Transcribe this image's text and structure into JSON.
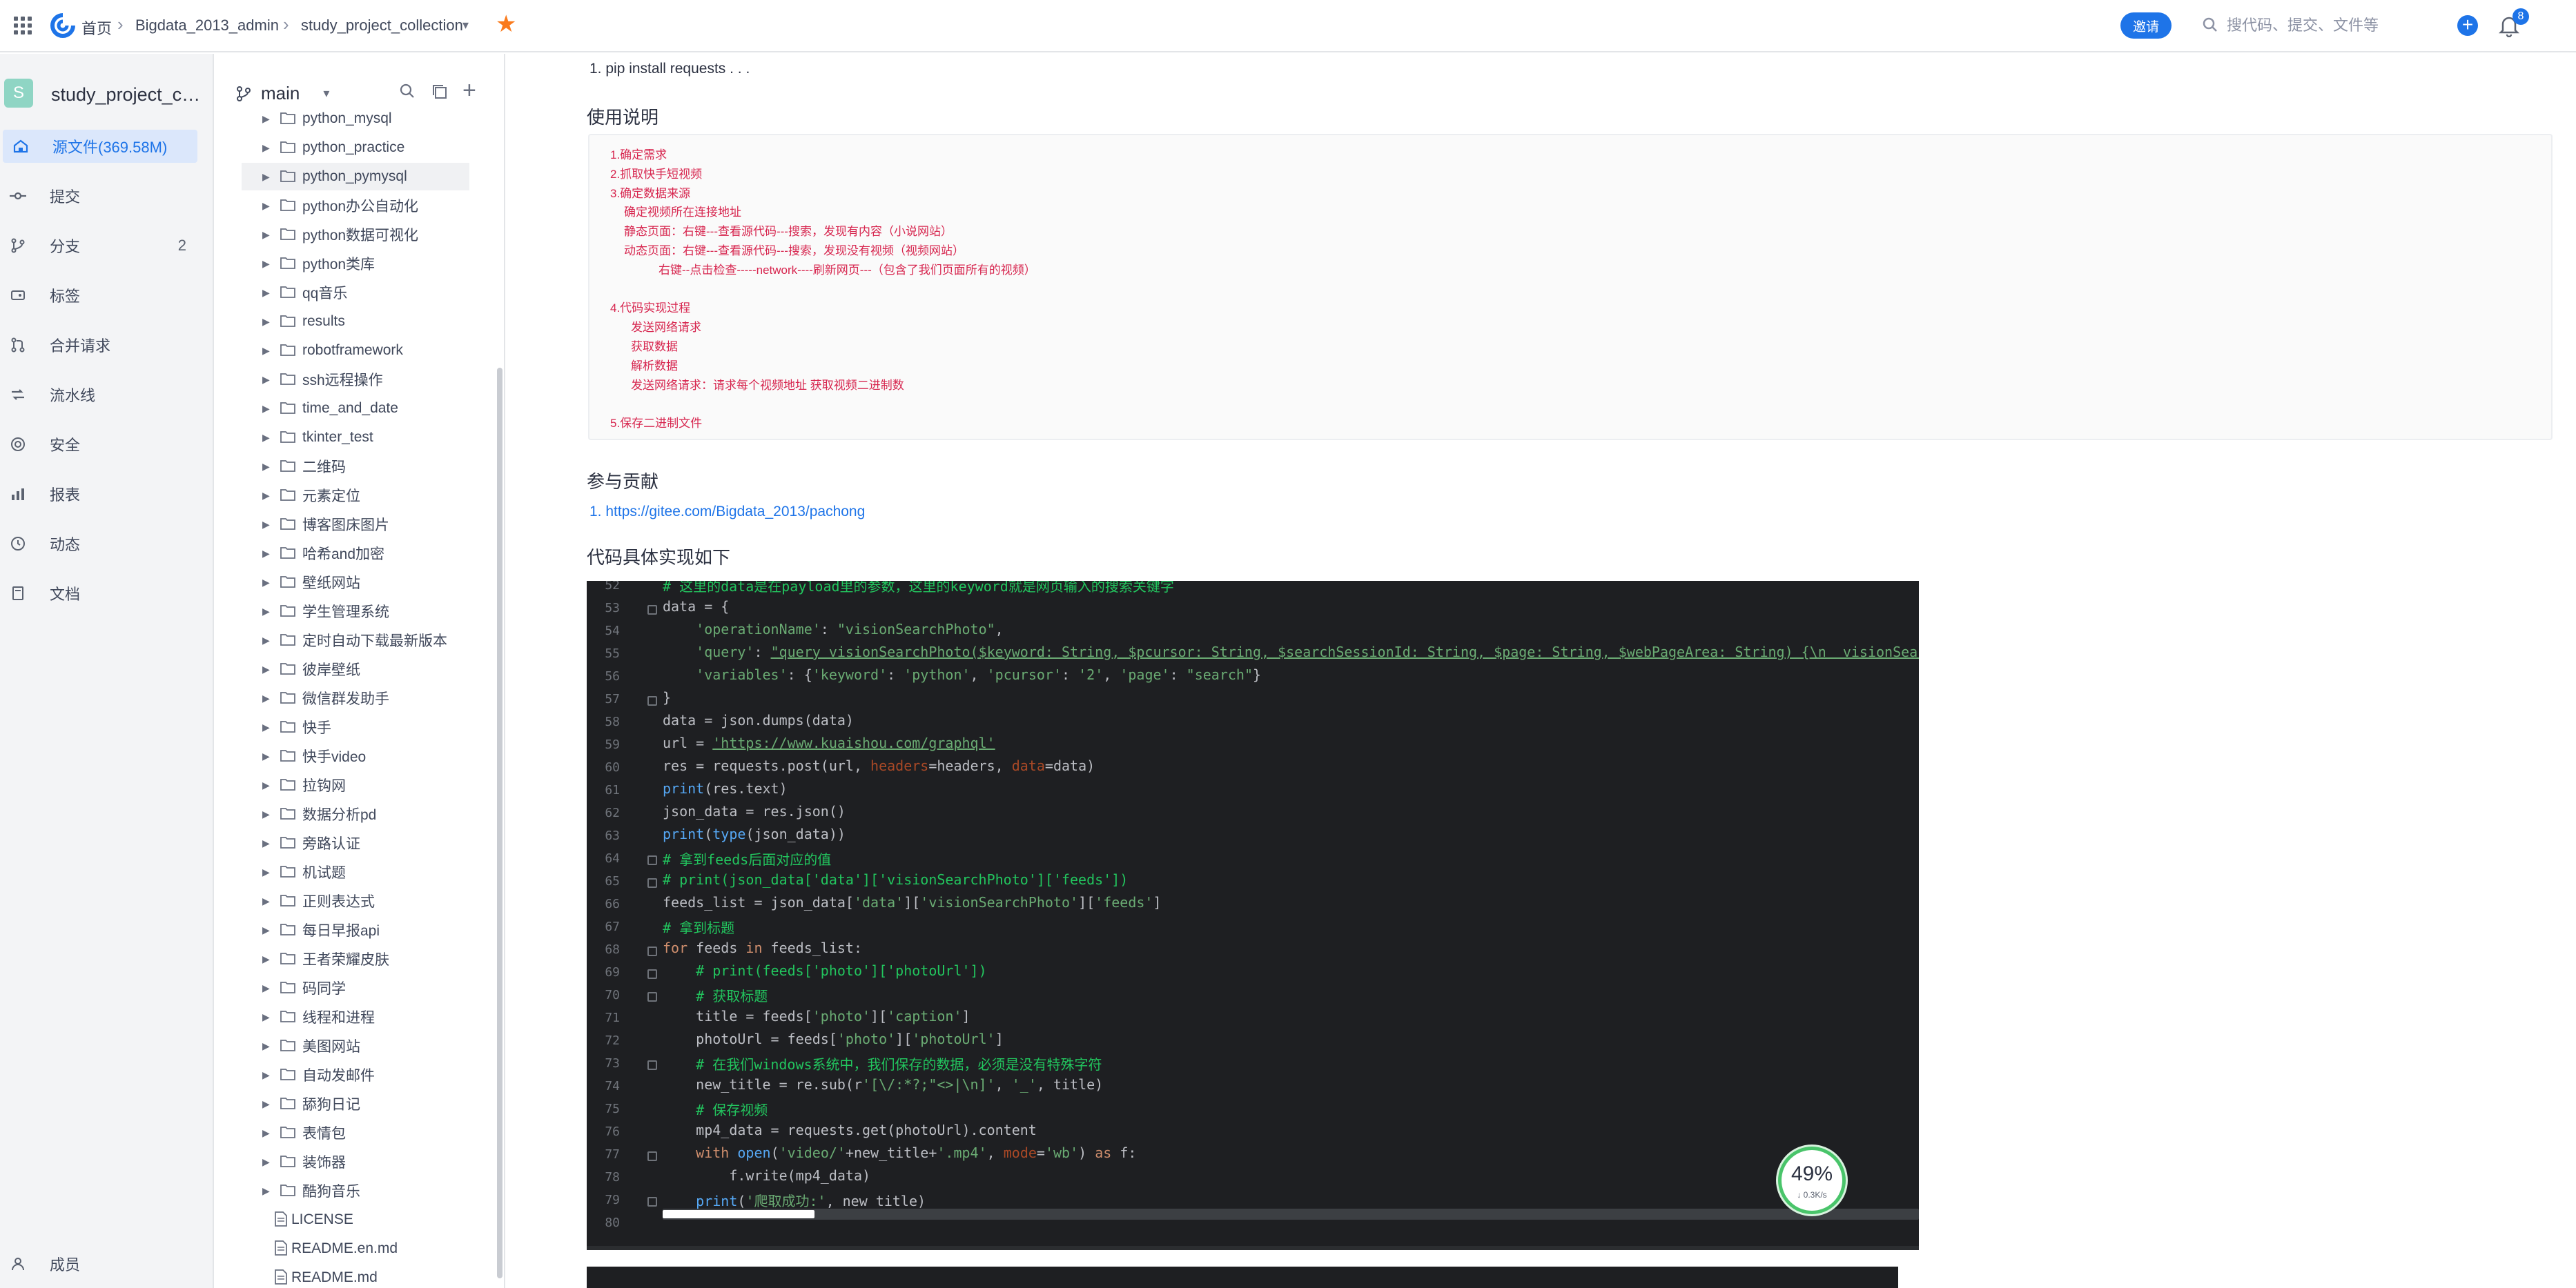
{
  "topbar": {
    "breadcrumb": [
      "首页",
      "Bigdata_2013_admin",
      "study_project_collection"
    ],
    "invite_label": "邀请",
    "search_placeholder": "搜代码、提交、文件等",
    "notifications_count": "8"
  },
  "leftnav": {
    "repo_initial": "S",
    "repo_name": "study_project_col...",
    "items": [
      {
        "label": "源文件(369.58M)",
        "icon": "folder-icon",
        "active": true
      },
      {
        "label": "提交",
        "icon": "commit-icon"
      },
      {
        "label": "分支",
        "icon": "branch-icon",
        "count": "2"
      },
      {
        "label": "标签",
        "icon": "tag-icon"
      },
      {
        "label": "合并请求",
        "icon": "merge-request-icon"
      },
      {
        "label": "流水线",
        "icon": "pipeline-icon"
      },
      {
        "label": "安全",
        "icon": "shield-icon"
      },
      {
        "label": "报表",
        "icon": "chart-icon"
      },
      {
        "label": "动态",
        "icon": "history-icon"
      },
      {
        "label": "文档",
        "icon": "book-icon"
      }
    ],
    "member_label": "成员"
  },
  "tree": {
    "branch": "main",
    "folders": [
      "python_mysql",
      "python_practice",
      "python_pymysql",
      "python办公自动化",
      "python数据可视化",
      "python类库",
      "qq音乐",
      "results",
      "robotframework",
      "ssh远程操作",
      "time_and_date",
      "tkinter_test",
      "二维码",
      "元素定位",
      "博客图床图片",
      "哈希and加密",
      "壁纸网站",
      "学生管理系统",
      "定时自动下载最新版本",
      "彼岸壁纸",
      "微信群发助手",
      "快手",
      "快手video",
      "拉钩网",
      "数据分析pd",
      "旁路认证",
      "机试题",
      "正则表达式",
      "每日早报api",
      "王者荣耀皮肤",
      "码同学",
      "线程和进程",
      "美图网站",
      "自动发邮件",
      "舔狗日记",
      "表情包",
      "装饰器",
      "酷狗音乐"
    ],
    "files": [
      "LICENSE",
      "README.en.md",
      "README.md"
    ]
  },
  "content": {
    "install_line": "1. pip install requests . . .",
    "usage_heading": "使用说明",
    "notes": [
      "1.确定需求",
      "2.抓取快手短视频",
      "3.确定数据来源",
      "  确定视频所在连接地址",
      "  静态页面：右键---查看源代码---搜索，发现有内容（小说网站）",
      "  动态页面：右键---查看源代码---搜索，发现没有视频（视频网站）",
      "       右键--点击检查-----network----刷新网页---（包含了我们页面所有的视频）",
      "",
      "4.代码实现过程",
      "   发送网络请求",
      "   获取数据",
      "   解析数据",
      "   发送网络请求：请求每个视频地址  获取视频二进制数",
      "",
      "5.保存二进制文件"
    ],
    "contrib_heading": "参与贡献",
    "contrib_line": "1. https://gitee.com/Bigdata_2013/pachong",
    "code_heading": "代码具体实现如下"
  },
  "code": {
    "line_numbers": [
      "52",
      "53",
      "54",
      "55",
      "56",
      "57",
      "58",
      "59",
      "60",
      "61",
      "62",
      "63",
      "64",
      "65",
      "66",
      "67",
      "68",
      "69",
      "70",
      "71",
      "72",
      "73",
      "74",
      "75",
      "76",
      "77",
      "78",
      "79",
      "80"
    ],
    "speed_percent": "49%",
    "speed_rate": "↓ 0.3K/s"
  },
  "colors": {
    "accent": "#1e74e8",
    "note_red": "#d7264f",
    "star": "#fa7a1c"
  }
}
